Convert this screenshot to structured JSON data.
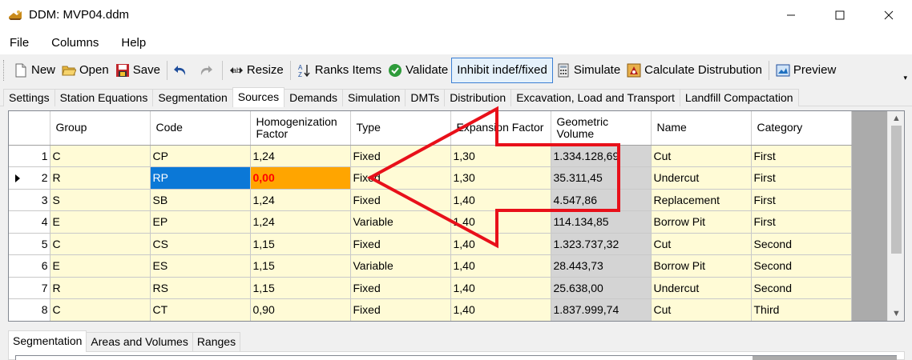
{
  "window": {
    "title": "DDM: MVP04.ddm",
    "minimize": "—",
    "maximize": "☐",
    "close": "✕"
  },
  "menu": [
    "File",
    "Columns",
    "Help"
  ],
  "toolbar": {
    "new": "New",
    "open": "Open",
    "save": "Save",
    "resize": "Resize",
    "ranks": "Ranks Items",
    "validate": "Validate",
    "inhibit": "Inhibit indef/fixed",
    "simulate": "Simulate",
    "calculate": "Calculate Distrubution",
    "preview": "Preview"
  },
  "tabs": [
    "Settings",
    "Station Equations",
    "Segmentation",
    "Sources",
    "Demands",
    "Simulation",
    "DMTs",
    "Distribution",
    "Excavation, Load and Transport",
    "Landfill Compactation"
  ],
  "active_tab": "Sources",
  "grid": {
    "columns": [
      "Group",
      "Code",
      "Homogenization Factor",
      "Type",
      "Expansion Factor",
      "Geometric Volume",
      "Name",
      "Category"
    ],
    "rows": [
      {
        "n": "1",
        "group": "C",
        "code": "CP",
        "hf": "1,24",
        "type": "Fixed",
        "ef": "1,30",
        "gv": "1.334.128,69",
        "name": "Cut",
        "category": "First"
      },
      {
        "n": "2",
        "group": "R",
        "code": "RP",
        "hf": "0,00",
        "type": "Fixed",
        "ef": "1,30",
        "gv": "35.311,45",
        "name": "Undercut",
        "category": "First"
      },
      {
        "n": "3",
        "group": "S",
        "code": "SB",
        "hf": "1,24",
        "type": "Fixed",
        "ef": "1,40",
        "gv": "4.547,86",
        "name": "Replacement",
        "category": "First"
      },
      {
        "n": "4",
        "group": "E",
        "code": "EP",
        "hf": "1,24",
        "type": "Variable",
        "ef": "1,40",
        "gv": "114.134,85",
        "name": "Borrow Pit",
        "category": "First"
      },
      {
        "n": "5",
        "group": "C",
        "code": "CS",
        "hf": "1,15",
        "type": "Fixed",
        "ef": "1,40",
        "gv": "1.323.737,32",
        "name": "Cut",
        "category": "Second"
      },
      {
        "n": "6",
        "group": "E",
        "code": "ES",
        "hf": "1,15",
        "type": "Variable",
        "ef": "1,40",
        "gv": "28.443,73",
        "name": "Borrow Pit",
        "category": "Second"
      },
      {
        "n": "7",
        "group": "R",
        "code": "RS",
        "hf": "1,15",
        "type": "Fixed",
        "ef": "1,40",
        "gv": "25.638,00",
        "name": "Undercut",
        "category": "Second"
      },
      {
        "n": "8",
        "group": "C",
        "code": "CT",
        "hf": "0,90",
        "type": "Fixed",
        "ef": "1,40",
        "gv": "1.837.999,74",
        "name": "Cut",
        "category": "Third"
      }
    ]
  },
  "bottom_tabs": [
    "Segmentation",
    "Areas and Volumes",
    "Ranges"
  ],
  "active_bottom_tab": "Segmentation",
  "colors": {
    "row_bg": "#fffbd6",
    "selected": "#0b78d7",
    "error_bg": "#ffa500",
    "error_text": "#ff0000",
    "arrow": "#e8101a",
    "readonly": "#d4d4d4"
  }
}
